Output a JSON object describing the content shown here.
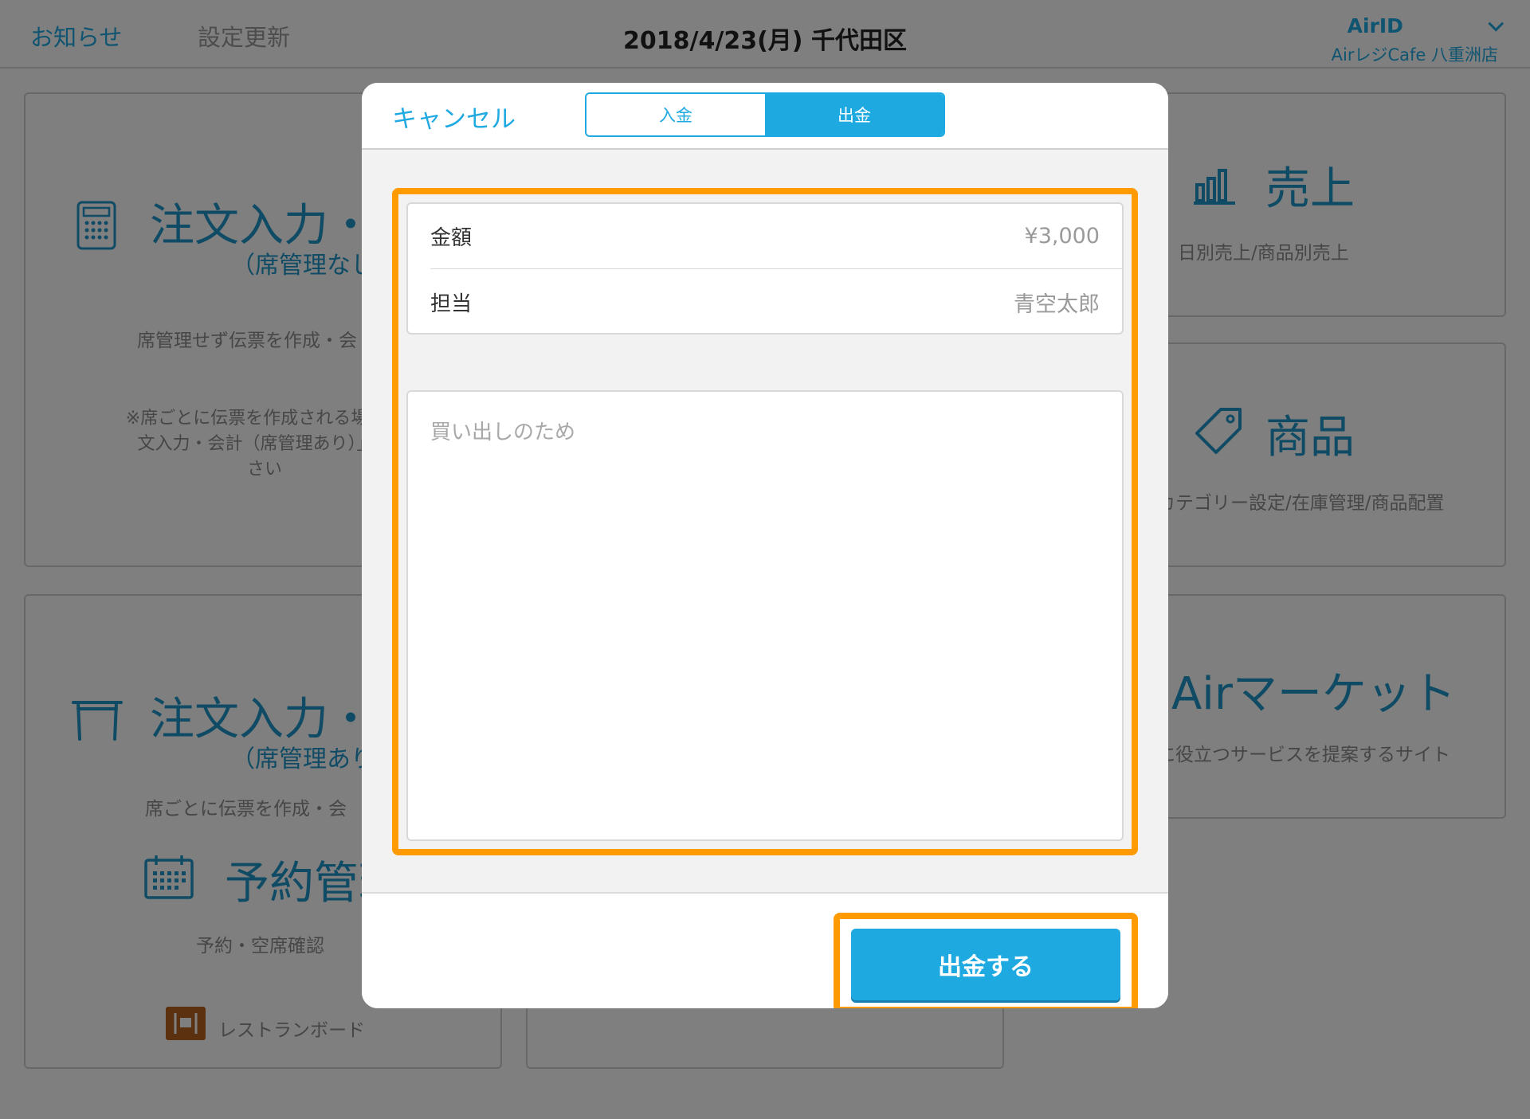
{
  "topbar": {
    "notices": "お知らせ",
    "settings_update": "設定更新",
    "date_location": "2018/4/23(月) 千代田区",
    "airid": "AirID",
    "store": "AirレジCafe 八重洲店"
  },
  "cards": {
    "order_no_seat": {
      "title": "注文入力・",
      "sub": "（席管理なし",
      "desc": "席管理せず伝票を作成・会",
      "note1": "※席ごとに伝票を作成される場合は",
      "note2": "文入力・会計（席管理あり）」を",
      "note3": "さい"
    },
    "sales": {
      "title": "売上",
      "desc": "日別売上/商品別売上"
    },
    "products": {
      "title": "商品",
      "desc": "カテゴリー設定/在庫管理/商品配置"
    },
    "order_seat": {
      "title": "注文入力・",
      "sub": "（席管理あり",
      "desc": "席ごとに伝票を作成・会"
    },
    "reservation": {
      "title": "予約管理",
      "desc": "予約・空席確認",
      "restaurant_board": "レストランボード"
    },
    "air_market": {
      "title": "Airマーケット",
      "desc": "に役立つサービスを提案するサイト"
    }
  },
  "modal": {
    "cancel": "キャンセル",
    "tabs": [
      "入金",
      "出金"
    ],
    "active_tab": "出金",
    "amount_label": "金額",
    "amount_value": "¥3,000",
    "staff_label": "担当",
    "staff_value": "青空太郎",
    "memo": "買い出しのため",
    "submit": "出金する"
  },
  "colors": {
    "accent": "#1fa9e1",
    "highlight": "#ff9a00"
  }
}
